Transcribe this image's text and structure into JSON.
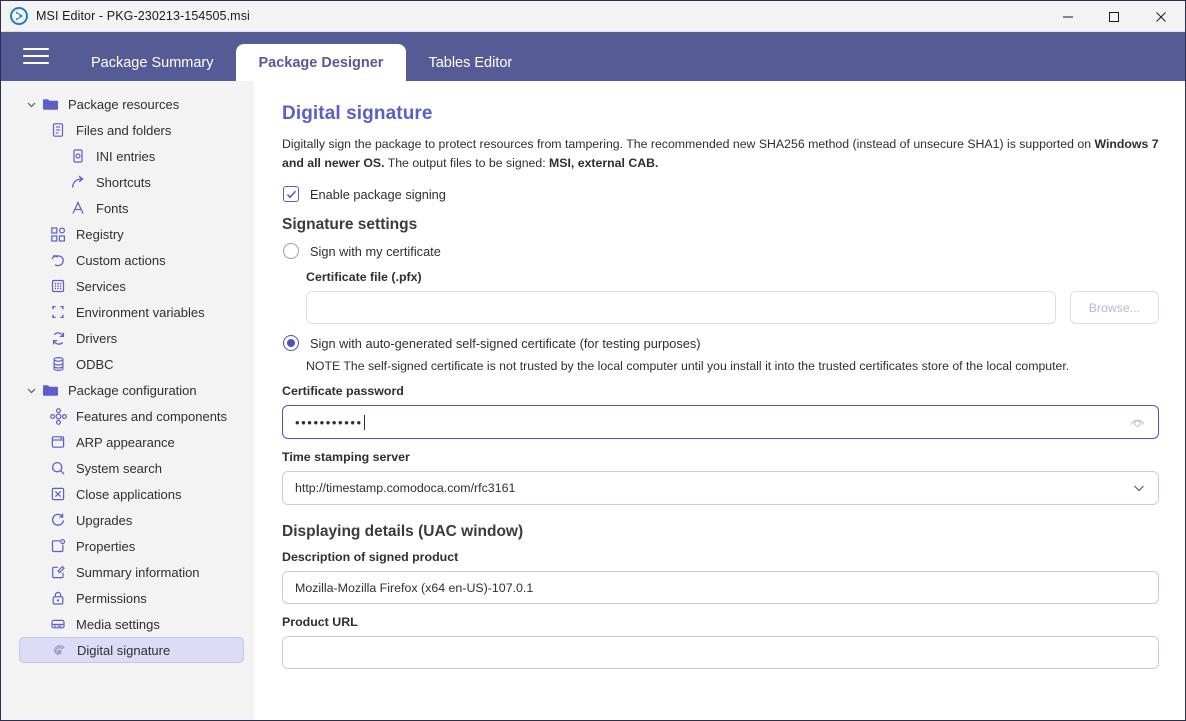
{
  "window": {
    "title": "MSI Editor - PKG-230213-154505.msi",
    "app_icon": "msi-editor-logo-icon",
    "controls": {
      "minimize": "minimize-icon",
      "maximize": "maximize-icon",
      "close": "close-icon"
    }
  },
  "topbar": {
    "menu_icon": "hamburger-menu-icon",
    "tabs": [
      {
        "label": "Package Summary",
        "active": false
      },
      {
        "label": "Package Designer",
        "active": true
      },
      {
        "label": "Tables Editor",
        "active": false
      }
    ]
  },
  "sidebar": {
    "items": [
      {
        "label": "Package resources",
        "level": 0,
        "icon": "folder-icon",
        "chevron": "chevron-down-icon",
        "selected": false
      },
      {
        "label": "Files and folders",
        "level": 1,
        "icon": "file-icon",
        "chevron": "",
        "selected": false
      },
      {
        "label": "INI entries",
        "level": 2,
        "icon": "ini-entries-icon",
        "chevron": "",
        "selected": false
      },
      {
        "label": "Shortcuts",
        "level": 2,
        "icon": "shortcut-arrow-icon",
        "chevron": "",
        "selected": false
      },
      {
        "label": "Fonts",
        "level": 2,
        "icon": "font-letter-a-icon",
        "chevron": "",
        "selected": false
      },
      {
        "label": "Registry",
        "level": 1,
        "icon": "registry-blocks-icon",
        "chevron": "",
        "selected": false
      },
      {
        "label": "Custom actions",
        "level": 1,
        "icon": "custom-action-arrow-icon",
        "chevron": "",
        "selected": false
      },
      {
        "label": "Services",
        "level": 1,
        "icon": "services-grid-icon",
        "chevron": "",
        "selected": false
      },
      {
        "label": "Environment variables",
        "level": 1,
        "icon": "environment-brackets-icon",
        "chevron": "",
        "selected": false
      },
      {
        "label": "Drivers",
        "level": 1,
        "icon": "drivers-refresh-icon",
        "chevron": "",
        "selected": false
      },
      {
        "label": "ODBC",
        "level": 1,
        "icon": "database-icon",
        "chevron": "",
        "selected": false
      },
      {
        "label": "Package configuration",
        "level": 0,
        "icon": "folder-icon",
        "chevron": "chevron-down-icon",
        "selected": false
      },
      {
        "label": "Features and components",
        "level": 1,
        "icon": "features-nodes-icon",
        "chevron": "",
        "selected": false
      },
      {
        "label": "ARP appearance",
        "level": 1,
        "icon": "window-icon",
        "chevron": "",
        "selected": false
      },
      {
        "label": "System search",
        "level": 1,
        "icon": "search-icon",
        "chevron": "",
        "selected": false
      },
      {
        "label": "Close applications",
        "level": 1,
        "icon": "close-box-icon",
        "chevron": "",
        "selected": false
      },
      {
        "label": "Upgrades",
        "level": 1,
        "icon": "upgrade-refresh-icon",
        "chevron": "",
        "selected": false
      },
      {
        "label": "Properties",
        "level": 1,
        "icon": "properties-icon",
        "chevron": "",
        "selected": false
      },
      {
        "label": "Summary information",
        "level": 1,
        "icon": "edit-square-icon",
        "chevron": "",
        "selected": false
      },
      {
        "label": "Permissions",
        "level": 1,
        "icon": "lock-icon",
        "chevron": "",
        "selected": false
      },
      {
        "label": "Media settings",
        "level": 1,
        "icon": "media-disk-icon",
        "chevron": "",
        "selected": false
      },
      {
        "label": "Digital signature",
        "level": 1,
        "icon": "fingerprint-icon",
        "chevron": "",
        "selected": true
      }
    ]
  },
  "main": {
    "title": "Digital signature",
    "description": {
      "part1": "Digitally sign the package to protect resources from tampering. The recommended new SHA256 method (instead of unsecure SHA1) is supported on ",
      "bold1": "Windows 7 and all newer OS.",
      "part2": " The output files to be signed: ",
      "bold2": "MSI, external CAB."
    },
    "enable_signing": {
      "label": "Enable package signing",
      "checked": true,
      "check_icon": "checkmark-icon"
    },
    "signature_settings": {
      "heading": "Signature settings",
      "option_own": {
        "label": "Sign with my certificate",
        "selected": false
      },
      "certificate_file": {
        "label": "Certificate file (.pfx)",
        "value": "",
        "placeholder": "",
        "disabled": true
      },
      "browse_button": {
        "label": "Browse...",
        "disabled": true
      },
      "option_self_signed": {
        "label": "Sign with auto-generated self-signed certificate (for testing purposes)",
        "selected": true
      },
      "note": "NOTE The self-signed certificate is not trusted by the local computer until you install it into the trusted certificates store of the local computer.",
      "certificate_password": {
        "label": "Certificate password",
        "value": "•••••••••••",
        "focused": true,
        "reveal_icon": "eye-icon"
      },
      "timestamp_server": {
        "label": "Time stamping server",
        "value": "http://timestamp.comodoca.com/rfc3161",
        "chevron": "chevron-down-icon"
      }
    },
    "uac_details": {
      "heading": "Displaying details (UAC window)",
      "description_of_signed_product": {
        "label": "Description of signed product",
        "value": "Mozilla-Mozilla Firefox (x64 en-US)-107.0.1"
      },
      "product_url": {
        "label": "Product URL",
        "value": "",
        "placeholder": ""
      }
    }
  },
  "colors": {
    "accent": "#5b5fc7",
    "topbar": "#565b95",
    "sidebar_bg": "#f3f3f3",
    "selected_item": "#dcdcf7"
  }
}
